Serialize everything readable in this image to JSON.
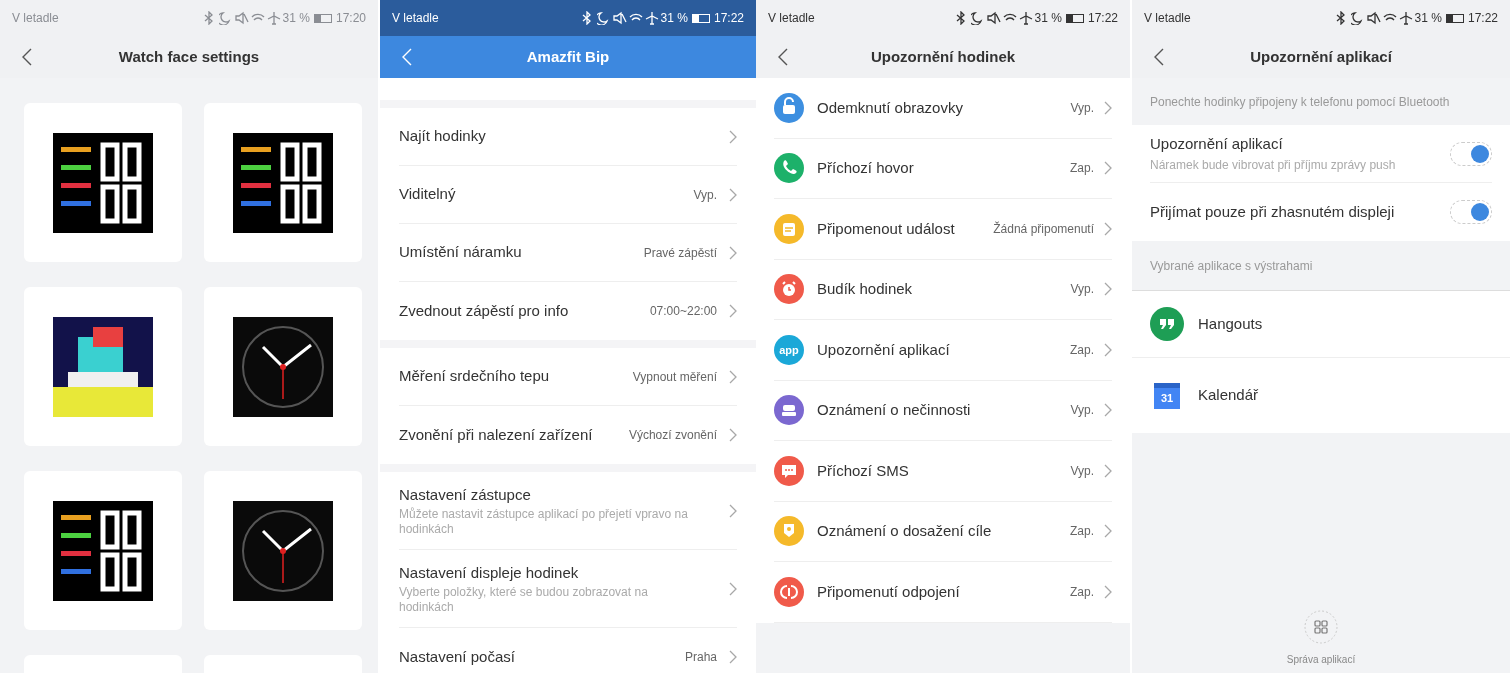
{
  "watch_face_screen": {
    "status_bar": {
      "carrier": "V letadle",
      "battery": "31 %",
      "time": "17:20"
    },
    "title": "Watch face settings",
    "watch_faces": [
      {
        "kind": "digital"
      },
      {
        "kind": "digital"
      },
      {
        "kind": "pixel"
      },
      {
        "kind": "analog"
      },
      {
        "kind": "digital"
      },
      {
        "kind": "analog"
      },
      {
        "kind": "partial"
      },
      {
        "kind": "partial"
      }
    ]
  },
  "device_screen": {
    "status_bar": {
      "carrier": "V letadle",
      "battery": "31 %",
      "time": "17:22"
    },
    "title": "Amazfit Bip",
    "groups": [
      {
        "items": [
          {
            "label": "Najít hodinky"
          },
          {
            "label": "Viditelný",
            "value": "Vyp."
          },
          {
            "label": "Umístění náramku",
            "value": "Pravé zápěstí"
          },
          {
            "label": "Zvednout zápěstí pro info",
            "value": "07:00~22:00"
          }
        ]
      },
      {
        "items": [
          {
            "label": "Měření srdečního tepu",
            "value": "Vypnout měření"
          },
          {
            "label": "Zvonění při nalezení zařízení",
            "value": "Výchozí zvonění"
          }
        ]
      },
      {
        "items": [
          {
            "label": "Nastavení zástupce",
            "description": "Můžete nastavit zástupce aplikací po přejetí vpravo na hodinkách"
          },
          {
            "label": "Nastavení displeje hodinek",
            "description": "Vyberte položky, které se budou zobrazovat na hodinkách"
          },
          {
            "label": "Nastavení počasí",
            "value": "Praha"
          }
        ]
      }
    ]
  },
  "notifications_screen": {
    "status_bar": {
      "carrier": "V letadle",
      "battery": "31 %",
      "time": "17:22"
    },
    "title": "Upozornění hodinek",
    "items": [
      {
        "kind": "lock",
        "color": "#3d8fe0",
        "label": "Odemknutí obrazovky",
        "value": "Vyp."
      },
      {
        "kind": "phone",
        "color": "#1db16a",
        "label": "Příchozí hovor",
        "value": "Zap."
      },
      {
        "kind": "note",
        "color": "#f5b92a",
        "label": "Připomenout událost",
        "value": "Žádná připomenutí"
      },
      {
        "kind": "alarm",
        "color": "#f05a4a",
        "label": "Budík hodinek",
        "value": "Vyp."
      },
      {
        "kind": "text",
        "icon_text": "app",
        "color": "#1ba8d8",
        "label": "Upozornění aplikací",
        "value": "Zap."
      },
      {
        "kind": "seat",
        "color": "#7b68d0",
        "label": "Oznámení o nečinnosti",
        "value": "Vyp."
      },
      {
        "kind": "message",
        "color": "#f05a4a",
        "label": "Příchozí SMS",
        "value": "Vyp."
      },
      {
        "kind": "medal",
        "color": "#f5b92a",
        "label": "Oznámení o dosažení cíle",
        "value": "Zap."
      },
      {
        "kind": "unlink",
        "color": "#f05a4a",
        "label": "Připomenutí odpojení",
        "value": "Zap."
      }
    ]
  },
  "app_alerts_screen": {
    "status_bar": {
      "carrier": "V letadle",
      "battery": "31 %",
      "time": "17:22"
    },
    "title": "Upozornění aplikací",
    "note": "Ponechte hodinky připojeny k telefonu pomocí Bluetooth",
    "toggles": [
      {
        "label": "Upozornění aplikací",
        "description": "Náramek bude vibrovat při příjmu zprávy push",
        "on": true
      },
      {
        "label": "Přijímat pouze při zhasnutém displeji",
        "on": true
      }
    ],
    "apps_header": "Vybrané aplikace s výstrahami",
    "apps": [
      {
        "kind": "chat",
        "name": "Hangouts"
      },
      {
        "kind": "calendar",
        "icon_text": "31",
        "name": "Kalendář"
      }
    ],
    "manage_button": "Správa aplikací"
  }
}
